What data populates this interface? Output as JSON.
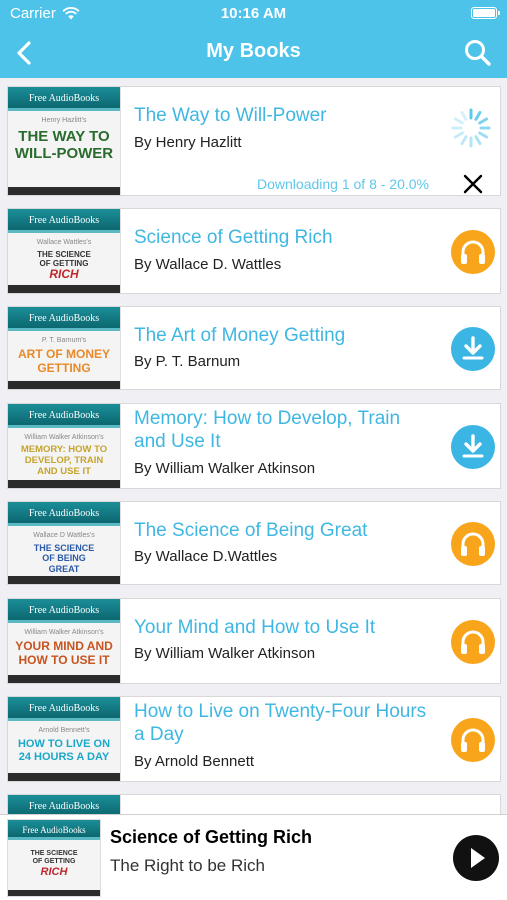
{
  "status_bar": {
    "carrier": "Carrier",
    "time": "10:16 AM"
  },
  "nav": {
    "title": "My Books"
  },
  "cover_brand": "Free AudioBooks",
  "books": [
    {
      "title": "The Way to Will-Power",
      "author": "By Henry Hazlitt",
      "cover_author": "Henry Hazlitt's",
      "cover_lines": [
        "THE WAY TO",
        "WILL-POWER"
      ],
      "cover_color": "#2a6b2e",
      "state": "downloading",
      "progress_text": "Downloading 1 of 8 - 20.0%"
    },
    {
      "title": "Science of Getting Rich",
      "author": "By Wallace D. Wattles",
      "cover_author": "Wallace Wattles's",
      "cover_lines": [
        "THE SCIENCE",
        "OF GETTING",
        "RICH"
      ],
      "cover_color": "#c0272d",
      "state": "audio"
    },
    {
      "title": "The Art of Money Getting",
      "author": "By P. T. Barnum",
      "cover_author": "P. T. Barnum's",
      "cover_lines": [
        "ART OF MONEY",
        "GETTING"
      ],
      "cover_color": "#e8892a",
      "state": "download"
    },
    {
      "title": "Memory: How to Develop, Train and Use It",
      "author": "By William Walker Atkinson",
      "cover_author": "William Walker Atkinson's",
      "cover_lines": [
        "MEMORY: HOW TO",
        "DEVELOP, TRAIN",
        "AND USE IT"
      ],
      "cover_color": "#c6a32b",
      "state": "download"
    },
    {
      "title": "The Science of Being Great",
      "author": "By Wallace D.Wattles",
      "cover_author": "Wallace D Wattles's",
      "cover_lines": [
        "THE SCIENCE",
        "OF BEING",
        "GREAT"
      ],
      "cover_color": "#2a5aa8",
      "state": "audio"
    },
    {
      "title": "Your Mind and How to Use It",
      "author": "By William Walker Atkinson",
      "cover_author": "William Walker Atkinson's",
      "cover_lines": [
        "YOUR MIND AND",
        "HOW TO USE IT"
      ],
      "cover_color": "#c8541f",
      "state": "audio"
    },
    {
      "title": "How to Live on Twenty-Four Hours a Day",
      "author": "By Arnold Bennett",
      "cover_author": "Arnold Bennett's",
      "cover_lines": [
        "HOW TO LIVE ON",
        "24 HOURS A DAY"
      ],
      "cover_color": "#1aa8c9",
      "state": "audio"
    },
    {
      "title": "",
      "author": "",
      "cover_author": "",
      "cover_lines": [],
      "cover_color": "#1aa8c9",
      "state": "none"
    }
  ],
  "player": {
    "title": "Science of Getting Rich",
    "subtitle": "The Right to be Rich",
    "cover_lines": [
      "THE SCIENCE",
      "OF GETTING",
      "RICH"
    ],
    "cover_color": "#c0272d"
  },
  "colors": {
    "accent": "#4ec3ea",
    "link_text": "#3fb7e2",
    "audio": "#f9a51c",
    "download": "#3ab5e4"
  },
  "icons": {
    "back": "chevron-left-icon",
    "search": "search-icon",
    "audio": "headphones-icon",
    "download": "download-icon",
    "cancel": "close-icon",
    "play": "play-icon",
    "loading": "spinner-icon"
  }
}
